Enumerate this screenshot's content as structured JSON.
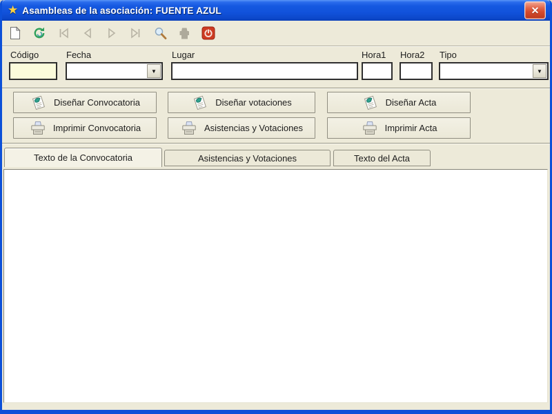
{
  "window": {
    "title": "Asambleas de la asociación: FUENTE AZUL",
    "app_icon_glyph": "★",
    "close_icon_glyph": "✕"
  },
  "toolbar": {
    "icons": [
      {
        "name": "new-record",
        "enabled": true
      },
      {
        "name": "refresh",
        "enabled": true
      },
      {
        "name": "first-record",
        "enabled": false
      },
      {
        "name": "previous-record",
        "enabled": false
      },
      {
        "name": "next-record",
        "enabled": false
      },
      {
        "name": "last-record",
        "enabled": false
      },
      {
        "name": "search",
        "enabled": true
      },
      {
        "name": "print",
        "enabled": false
      },
      {
        "name": "exit",
        "enabled": true
      }
    ]
  },
  "form": {
    "fields": {
      "codigo": {
        "label": "Código",
        "value": ""
      },
      "fecha": {
        "label": "Fecha",
        "value": ""
      },
      "lugar": {
        "label": "Lugar",
        "value": ""
      },
      "hora1": {
        "label": "Hora1",
        "value": ""
      },
      "hora2": {
        "label": "Hora2",
        "value": ""
      },
      "tipo": {
        "label": "Tipo",
        "value": ""
      }
    },
    "dropdown_arrow_glyph": "▼"
  },
  "actions": {
    "disenar_convocatoria": "Diseñar Convocatoria",
    "disenar_votaciones": "Diseñar votaciones",
    "disenar_acta": "Diseñar Acta",
    "imprimir_convocatoria": "Imprimir Convocatoria",
    "asistencias_votaciones": "Asistencias y Votaciones",
    "imprimir_acta": "Imprimir Acta"
  },
  "tabs": [
    {
      "label": "Texto de la Convocatoria",
      "active": true
    },
    {
      "label": "Asistencias y Votaciones",
      "active": false
    },
    {
      "label": "Texto del Acta",
      "active": false
    }
  ],
  "content": {
    "text": ""
  },
  "colors": {
    "titlebar_blue": "#1152DB",
    "window_border_blue": "#0D50D8",
    "face_beige": "#EDEAD9",
    "input_yellow": "#FBFBDB",
    "close_red": "#D44A2C",
    "accent_teal": "#2FA08D",
    "disabled_gray": "#B5B1A2"
  }
}
